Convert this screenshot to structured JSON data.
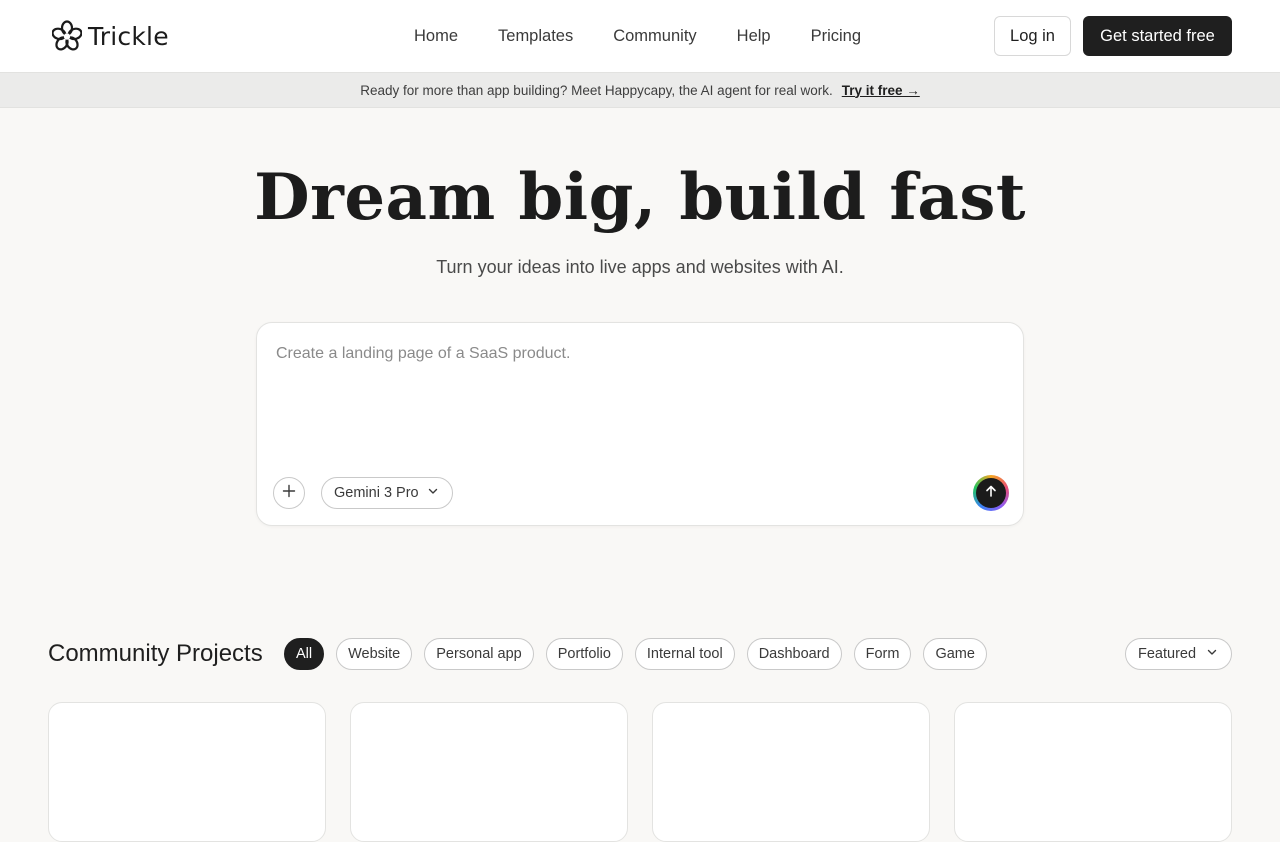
{
  "brand": {
    "name": "Trickle"
  },
  "nav": {
    "items": [
      {
        "label": "Home"
      },
      {
        "label": "Templates"
      },
      {
        "label": "Community"
      },
      {
        "label": "Help"
      },
      {
        "label": "Pricing"
      }
    ],
    "login_label": "Log in",
    "cta_label": "Get started free"
  },
  "banner": {
    "text": "Ready for more than app building? Meet Happycapy, the AI agent for real work.",
    "link_label": "Try it free →"
  },
  "hero": {
    "title": "Dream big, build fast",
    "subtitle": "Turn your ideas into live apps and websites with AI."
  },
  "prompt": {
    "placeholder": "Create a landing page of a SaaS product.",
    "value": "",
    "attach_icon": "plus-icon",
    "model": "Gemini 3 Pro",
    "send_icon": "arrow-up-icon"
  },
  "community": {
    "title": "Community Projects",
    "filters": [
      {
        "label": "All",
        "active": true
      },
      {
        "label": "Website",
        "active": false
      },
      {
        "label": "Personal app",
        "active": false
      },
      {
        "label": "Portfolio",
        "active": false
      },
      {
        "label": "Internal tool",
        "active": false
      },
      {
        "label": "Dashboard",
        "active": false
      },
      {
        "label": "Form",
        "active": false
      },
      {
        "label": "Game",
        "active": false
      }
    ],
    "sort": "Featured"
  },
  "colors": {
    "background": "#f9f8f6",
    "primary_dark": "#1f1f1f",
    "banner_bg": "#ebebea",
    "border": "#c9c9c9"
  }
}
